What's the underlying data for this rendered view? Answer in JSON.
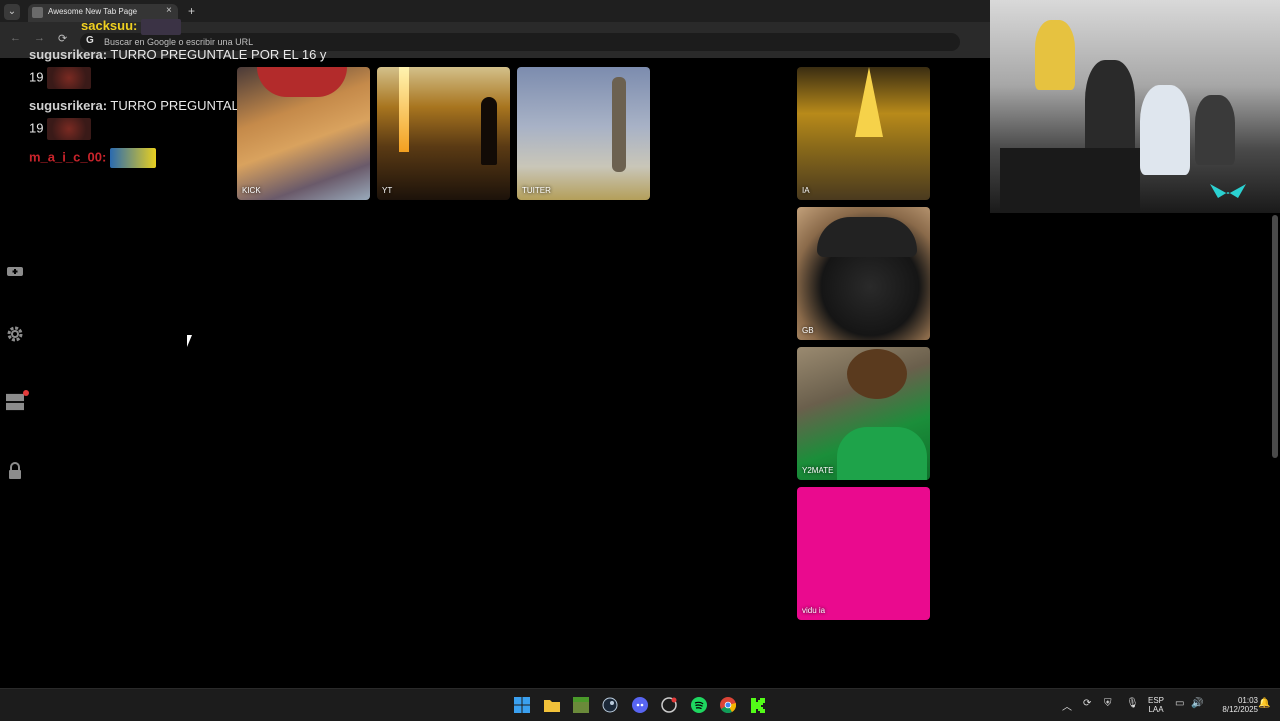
{
  "browser": {
    "tab_title": "Awesome New Tab Page",
    "tab_close": "×",
    "new_tab": "+",
    "tab_dropdown": "⌄",
    "omnibox_icon": "G",
    "omnibox_placeholder": "Buscar en Google o escribir una URL",
    "back": "←",
    "forward": "→",
    "reload": "⟳"
  },
  "chat": {
    "lines": [
      {
        "user": "sacksuu:",
        "message": ""
      },
      {
        "user": "sugusrikera:",
        "message": " TURRO PREGUNTALE POR EL 16 y"
      },
      {
        "user": "",
        "message": "19"
      },
      {
        "user": "sugusrikera:",
        "message": " TURRO PREGUNTALE POR EL 16 y"
      },
      {
        "user": "",
        "message": "19"
      },
      {
        "user": "m_a_i_c_00:",
        "message": ""
      }
    ]
  },
  "tiles": [
    {
      "label": "KICK"
    },
    {
      "label": "YT"
    },
    {
      "label": "TUITER"
    },
    {
      "label": "IA"
    },
    {
      "label": "GB"
    },
    {
      "label": "Y2MATE"
    },
    {
      "label": "vidu ia"
    }
  ],
  "sidebar": {
    "icons": [
      "widget-add-icon",
      "gear-icon",
      "apps-icon",
      "lock-icon"
    ]
  },
  "taskbar": {
    "icons": [
      "windows-start-icon",
      "file-explorer-icon",
      "minecraft-icon",
      "steam-icon",
      "discord-icon",
      "obs-icon",
      "spotify-icon",
      "chrome-icon",
      "kick-icon"
    ],
    "tray": {
      "lang_top": "ESP",
      "lang_bottom": "LAA",
      "time": "01:03",
      "date": "8/12/2025"
    }
  },
  "colors": {
    "background": "#000000",
    "vidu_tile": "#ea0a8e",
    "chat_red_user": "#c8242b"
  }
}
